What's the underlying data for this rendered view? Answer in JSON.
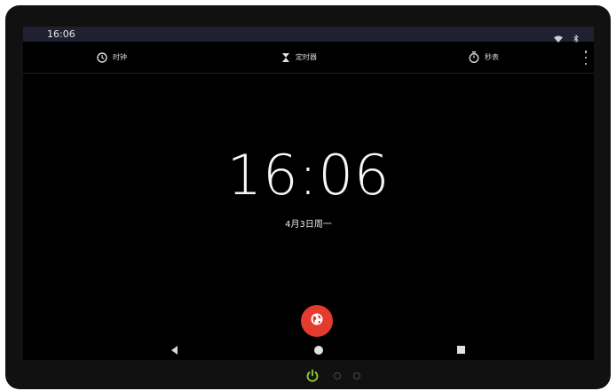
{
  "status_bar": {
    "time": "16:06",
    "icons": [
      "wifi-icon",
      "bluetooth-icon"
    ]
  },
  "tabs": [
    {
      "label": "时钟",
      "icon": "clock-icon"
    },
    {
      "label": "定时器",
      "icon": "hourglass-icon"
    },
    {
      "label": "秒表",
      "icon": "stopwatch-icon"
    }
  ],
  "overflow_menu_icon": "more-vert-icon",
  "clock": {
    "time": "16:06",
    "date": "4月3日周一"
  },
  "fab": {
    "icon": "globe-icon",
    "color": "#e53b2e"
  },
  "navigation": {
    "icons": [
      "back-icon",
      "home-icon",
      "recents-icon"
    ]
  },
  "device": {
    "power_icon_color": "#9acd32"
  }
}
